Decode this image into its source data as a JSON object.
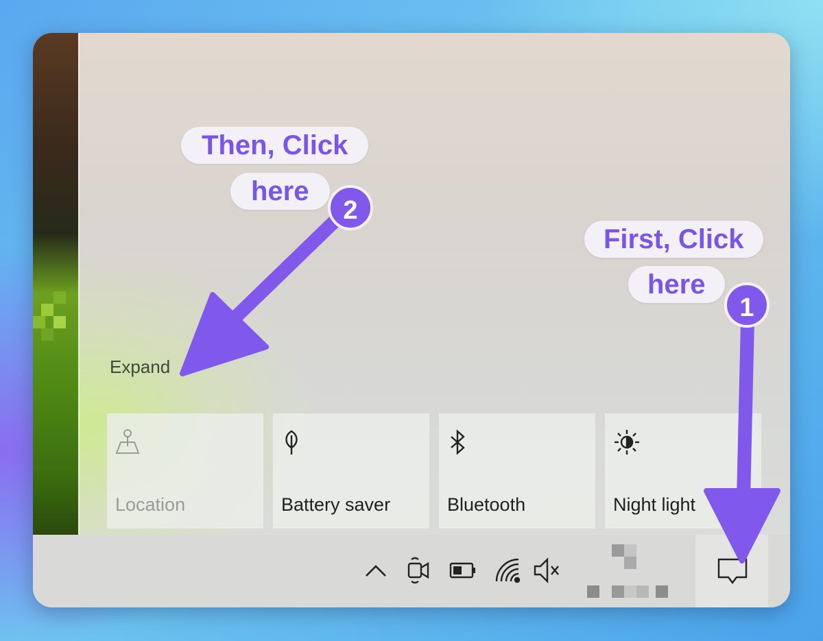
{
  "action_center": {
    "expand_label": "Expand",
    "tiles": [
      {
        "label": "Location",
        "icon": "location-icon",
        "state": "disabled"
      },
      {
        "label": "Battery saver",
        "icon": "leaf-icon",
        "state": "off"
      },
      {
        "label": "Bluetooth",
        "icon": "bluetooth-icon",
        "state": "off"
      },
      {
        "label": "Night light",
        "icon": "brightness-icon",
        "state": "off"
      }
    ]
  },
  "taskbar": {
    "tray_icons": [
      "chevron-up-icon",
      "meet-now-icon",
      "battery-icon",
      "wifi-icon",
      "speaker-muted-icon"
    ],
    "notification_icon": "notification-icon"
  },
  "annotations": {
    "step1": {
      "line1": "First, Click",
      "line2": "here",
      "badge": "1"
    },
    "step2": {
      "line1": "Then, Click",
      "line2": "here",
      "badge": "2"
    },
    "accent_color": "#8058ec"
  }
}
